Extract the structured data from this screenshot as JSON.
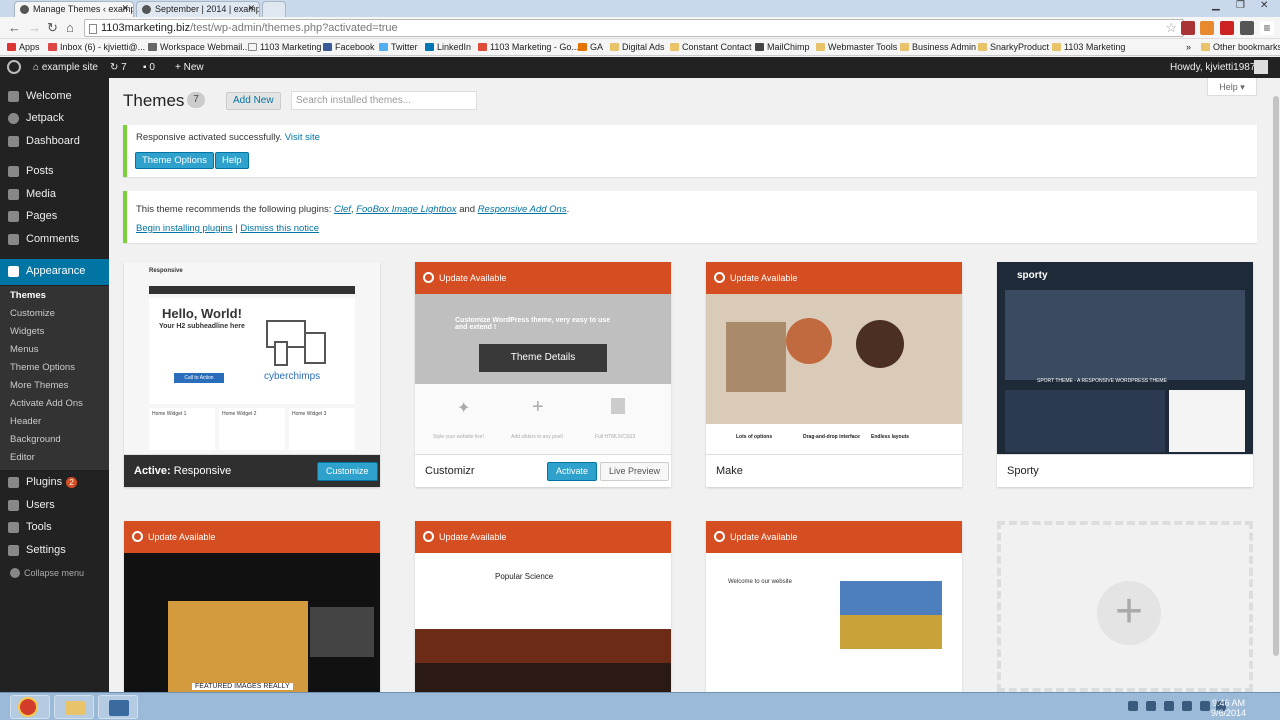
{
  "browser": {
    "tabs": [
      {
        "title": "Manage Themes ‹ exampl"
      },
      {
        "title": "September | 2014 | examp"
      }
    ],
    "url_host": "1103marketing.biz",
    "url_path": "/test/wp-admin/themes.php?activated=true",
    "bookmarks": [
      "Apps",
      "Inbox (6) - kjvietti@...",
      "Workspace Webmail...",
      "1103 Marketing",
      "Facebook",
      "Twitter",
      "LinkedIn",
      "1103 Marketing - Go...",
      "GA",
      "Digital Ads",
      "Constant Contact",
      "MailChimp",
      "Webmaster Tools",
      "Business Admin",
      "SnarkyProduct",
      "1103 Marketing"
    ],
    "bookmarks_more": "»",
    "other_bookmarks": "Other bookmarks"
  },
  "adminbar": {
    "site_name": "example site",
    "updates_count": "7",
    "comments_count": "0",
    "new_label": "New",
    "howdy": "Howdy, kjvietti1987"
  },
  "sidebar": {
    "welcome": "Welcome",
    "jetpack": "Jetpack",
    "dashboard": "Dashboard",
    "posts": "Posts",
    "media": "Media",
    "pages": "Pages",
    "comments": "Comments",
    "appearance": "Appearance",
    "sub": [
      "Themes",
      "Customize",
      "Widgets",
      "Menus",
      "Theme Options",
      "More Themes",
      "Activate Add Ons",
      "Header",
      "Background",
      "Editor"
    ],
    "plugins": "Plugins",
    "plugins_badge": "2",
    "users": "Users",
    "tools": "Tools",
    "settings": "Settings",
    "collapse": "Collapse menu"
  },
  "header": {
    "title": "Themes",
    "count": "7",
    "add_new": "Add New",
    "search_placeholder": "Search installed themes...",
    "help": "Help ▾"
  },
  "notice1": {
    "text": "Responsive activated successfully.",
    "link": "Visit site",
    "btn_options": "Theme Options",
    "btn_help": "Help"
  },
  "notice2": {
    "text": "This theme recommends the following plugins:",
    "plugin1": "Clef",
    "plugin2": "FooBox Image Lightbox",
    "and": "and",
    "plugin3": "Responsive Add Ons",
    "period": ".",
    "begin": "Begin installing plugins",
    "sep": "|",
    "dismiss": "Dismiss this notice"
  },
  "themes": {
    "responsive": {
      "active_prefix": "Active:",
      "name": "Responsive",
      "customize": "Customize",
      "shot_brand": "Responsive",
      "shot_hello": "Hello, World!",
      "shot_sub": "Your H2 subheadline here",
      "shot_cta": "Call to Action",
      "shot_logo": "cyberchimps",
      "shot_widgets": [
        "Home Widget 1",
        "Home Widget 2",
        "Home Widget 3"
      ]
    },
    "customizr": {
      "update": "Update Available",
      "name": "Customizr",
      "details": "Theme Details",
      "activate": "Activate",
      "preview": "Live Preview",
      "shot_head": "Customize WordPress theme, very easy to use and extend !",
      "features": [
        "Style your website live!",
        "Add sliders to any post!",
        "Full HTML5/CSS3"
      ]
    },
    "make": {
      "update": "Update Available",
      "name": "Make",
      "features": [
        "Lots of options",
        "Drag-and-drop interface",
        "Endless layouts"
      ]
    },
    "sporty": {
      "name": "Sporty",
      "logo": "sporty",
      "banner": "SPORT THEME - A RESPONSIVE WORDPRESS THEME"
    },
    "row2_a": {
      "update": "Update Available",
      "shot_caption": "FEATURED IMAGES REALLY"
    },
    "row2_b": {
      "update": "Update Available",
      "shot_title": "Popular Science"
    },
    "row2_c": {
      "update": "Update Available",
      "shot_title": "Welcome to our website"
    }
  },
  "taskbar": {
    "time": "9:46 AM",
    "date": "9/6/2014"
  }
}
